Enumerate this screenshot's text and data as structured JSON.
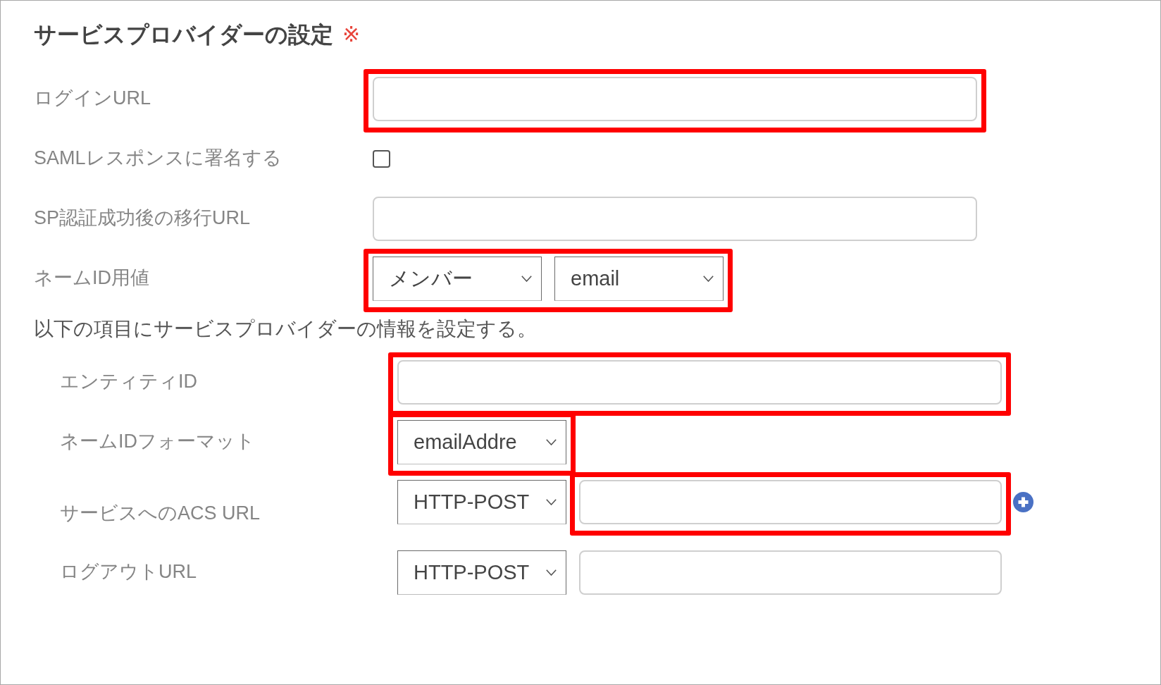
{
  "section": {
    "title": "サービスプロバイダーの設定",
    "required_mark": "※",
    "rows": [
      {
        "label": "ログインURL",
        "groups": [
          {
            "highlighted": true,
            "controls": [
              {
                "kind": "input"
              }
            ]
          }
        ]
      },
      {
        "label": "SAMLレスポンスに署名する",
        "groups": [
          {
            "highlighted": false,
            "controls": [
              {
                "kind": "checkbox",
                "checked": false
              }
            ]
          }
        ]
      },
      {
        "label": "SP認証成功後の移行URL",
        "groups": [
          {
            "highlighted": false,
            "controls": [
              {
                "kind": "input"
              }
            ]
          }
        ]
      },
      {
        "label": "ネームID用値",
        "groups": [
          {
            "highlighted": true,
            "controls": [
              {
                "kind": "select",
                "value": "メンバー"
              },
              {
                "kind": "select",
                "value": "email"
              }
            ]
          }
        ]
      }
    ]
  },
  "sp_info": {
    "intro": "以下の項目にサービスプロバイダーの情報を設定する。",
    "rows": [
      {
        "label": "エンティティID",
        "addable": false,
        "groups": [
          {
            "highlighted": true,
            "controls": [
              {
                "kind": "input"
              }
            ]
          }
        ]
      },
      {
        "label": "ネームIDフォーマット",
        "addable": false,
        "groups": [
          {
            "highlighted": true,
            "controls": [
              {
                "kind": "select",
                "value": "emailAddre"
              }
            ]
          }
        ]
      },
      {
        "label": "サービスへのACS URL",
        "addable": true,
        "groups": [
          {
            "highlighted": false,
            "controls": [
              {
                "kind": "select",
                "value": "HTTP-POST"
              }
            ]
          },
          {
            "highlighted": true,
            "controls": [
              {
                "kind": "input"
              }
            ]
          }
        ]
      },
      {
        "label": "ログアウトURL",
        "addable": false,
        "groups": [
          {
            "highlighted": false,
            "controls": [
              {
                "kind": "select",
                "value": "HTTP-POST"
              }
            ]
          },
          {
            "highlighted": false,
            "controls": [
              {
                "kind": "input"
              }
            ]
          }
        ]
      }
    ]
  }
}
